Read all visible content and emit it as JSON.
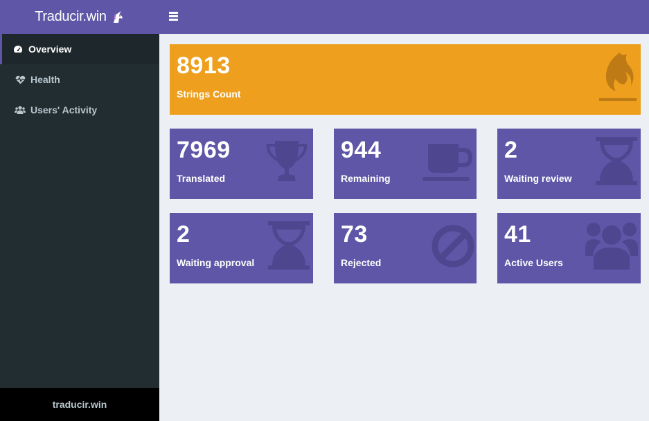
{
  "sidebar": {
    "brand": "Traducir.win",
    "items": [
      {
        "label": "Overview",
        "icon": "dashboard-icon"
      },
      {
        "label": "Health",
        "icon": "heartbeat-icon"
      },
      {
        "label": "Users' Activity",
        "icon": "users-icon"
      }
    ],
    "footer": "traducir.win"
  },
  "colors": {
    "accent": "#5f56a7",
    "orange": "#ed9f1d",
    "sidebar": "#222d32"
  },
  "stats": {
    "strings_count": {
      "value": "8913",
      "label": "Strings Count",
      "icon": "fire-icon"
    },
    "translated": {
      "value": "7969",
      "label": "Translated",
      "icon": "trophy-icon"
    },
    "remaining": {
      "value": "944",
      "label": "Remaining",
      "icon": "coffee-icon"
    },
    "waiting_review": {
      "value": "2",
      "label": "Waiting review",
      "icon": "hourglass-icon"
    },
    "waiting_approval": {
      "value": "2",
      "label": "Waiting approval",
      "icon": "hourglass-icon"
    },
    "rejected": {
      "value": "73",
      "label": "Rejected",
      "icon": "ban-icon"
    },
    "active_users": {
      "value": "41",
      "label": "Active Users",
      "icon": "users-icon"
    }
  }
}
